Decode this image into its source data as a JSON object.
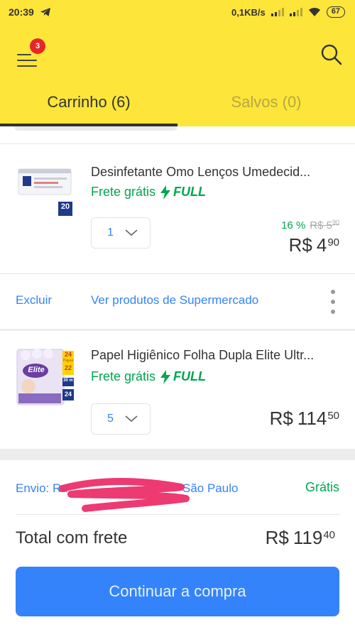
{
  "status_bar": {
    "time": "20:39",
    "network_speed": "0,1KB/s",
    "battery": "67",
    "icons": [
      "telegram-icon",
      "signal-icon",
      "signal-icon",
      "wifi-icon",
      "battery-icon"
    ]
  },
  "header": {
    "menu_badge": "3",
    "icons": [
      "menu-icon",
      "search-icon"
    ],
    "background_color": "#fde53a"
  },
  "tabs": [
    {
      "label": "Carrinho (6)",
      "active": true
    },
    {
      "label": "Salvos (0)",
      "active": false
    }
  ],
  "items": [
    {
      "title": "Desinfetante Omo Lenços Umedecid...",
      "shipping": "Frete grátis",
      "badge": "FULL",
      "quantity": "1",
      "discount_pct": "16 %",
      "old_price": "R$ 5",
      "old_price_cents": "90",
      "price_currency": "R$",
      "price_int": "4",
      "price_cents": "90",
      "thumb_count": "20"
    },
    {
      "title": "Papel Higiênico Folha Dupla Elite Ultr...",
      "shipping": "Frete grátis",
      "badge": "FULL",
      "quantity": "5",
      "price_currency": "R$",
      "price_int": "114",
      "price_cents": "50",
      "thumb_brand": "Elite",
      "thumb_tags": [
        "24",
        "Pague",
        "22"
      ],
      "thumb_meters": "30 m",
      "thumb_rolls": "24"
    }
  ],
  "actions": {
    "delete": "Excluir",
    "see_products": "Ver produtos de Supermercado"
  },
  "summary": {
    "shipping_label": "Envio: Ru",
    "shipping_city": "São Paulo",
    "shipping_value": "Grátis",
    "total_label": "Total com frete",
    "total_currency": "R$",
    "total_int": "119",
    "total_cents": "40",
    "cta": "Continuar a compra"
  },
  "colors": {
    "accent": "#3483fa",
    "success": "#00a650",
    "badge": "#e8262a"
  }
}
